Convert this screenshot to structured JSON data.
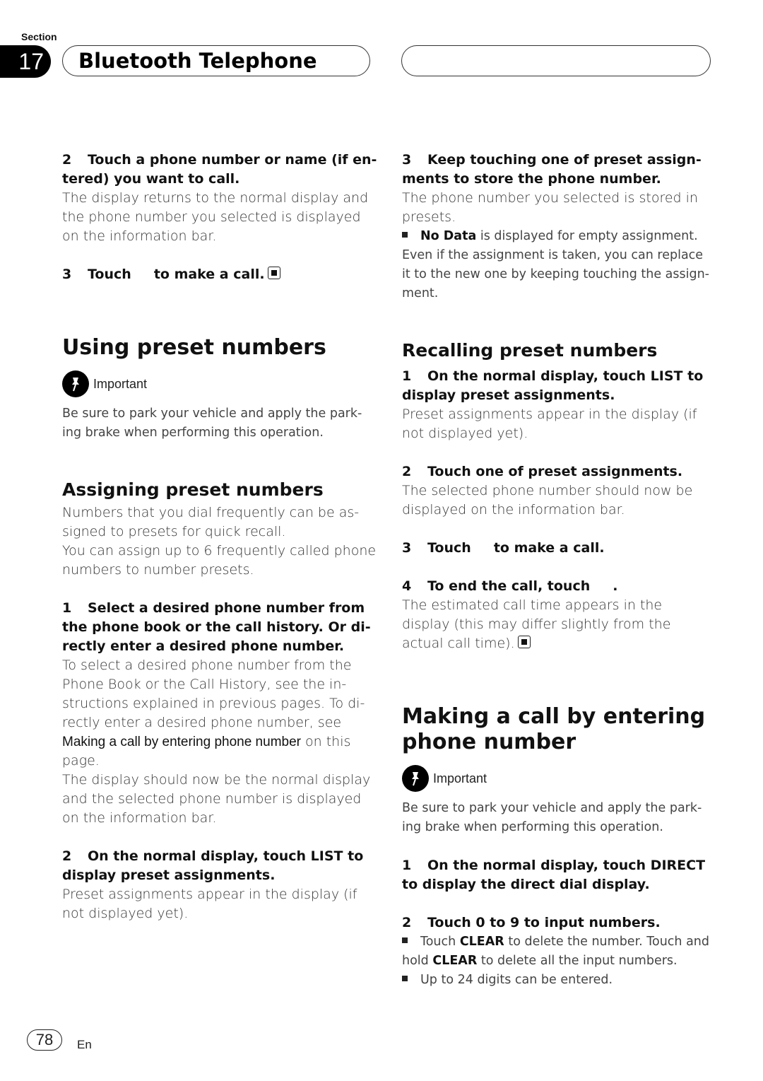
{
  "header": {
    "section_label": "Section",
    "section_number": "17",
    "title": "Bluetooth Telephone"
  },
  "left": {
    "step2": {
      "num": "2",
      "text": "Touch a phone number or name (if en-tered) you want to call."
    },
    "step2_body": "The display returns to the normal display and the phone number you selected is displayed on the information bar.",
    "step3": {
      "num": "3",
      "pre": "Touch",
      "post": "to make a call."
    },
    "using": {
      "title": "Using preset numbers",
      "important_label": "Important",
      "important_text": "Be sure to park your vehicle and apply the park-ing brake when performing this operation."
    },
    "assigning": {
      "title": "Assigning preset numbers",
      "p1": "Numbers that you dial frequently can be as-signed to presets for quick recall.",
      "p2": "You can assign up to 6 frequently called phone numbers to number presets.",
      "step1": {
        "num": "1",
        "text": "Select a desired phone number from the phone book or the call history. Or di-rectly enter a desired phone number."
      },
      "step1_body_pre": "To select a desired phone number from the Phone Book or the Call History, see the in-structions explained in previous pages. To di-rectly enter a desired phone number, see",
      "step1_ref": "Making a call by entering phone number",
      "step1_body_post": "on this page.",
      "step1_body2": "The display should now be the normal display and the selected phone number is displayed on the information bar.",
      "step2": {
        "num": "2",
        "text": "On the normal display, touch LIST to display preset assignments."
      },
      "step2_body": "Preset assignments appear in the display (if not displayed yet)."
    }
  },
  "right": {
    "step3": {
      "num": "3",
      "text": "Keep touching one of preset assign-ments to store the phone number."
    },
    "step3_body": "The phone number you selected is stored in presets.",
    "note_bold": "No Data",
    "note_text": "is displayed for empty assignment. Even if the assignment is taken, you can replace it to the new one by keeping touching the assign-ment.",
    "recalling": {
      "title": "Recalling preset numbers",
      "step1": {
        "num": "1",
        "text": "On the normal display, touch LIST to display preset assignments."
      },
      "step1_body": "Preset assignments appear in the display (if not displayed yet).",
      "step2": {
        "num": "2",
        "text": "Touch one of preset assignments."
      },
      "step2_body": "The selected phone number should now be displayed on the information bar.",
      "step3": {
        "num": "3",
        "pre": "Touch",
        "post": "to make a call."
      },
      "step4": {
        "num": "4",
        "pre": "To end the call, touch",
        "post": "."
      },
      "step4_body": "The estimated call time appears in the display (this may differ slightly from the actual call time)."
    },
    "making": {
      "title": "Making a call by entering phone number",
      "important_label": "Important",
      "important_text": "Be sure to park your vehicle and apply the park-ing brake when performing this operation.",
      "step1": {
        "num": "1",
        "text": "On the normal display, touch DIRECT to display the direct dial display."
      },
      "step2": {
        "num": "2",
        "text": "Touch 0 to 9 to input numbers."
      },
      "b1_pre": "Touch",
      "b1_bold1": "CLEAR",
      "b1_mid": "to delete the number. Touch and hold",
      "b1_bold2": "CLEAR",
      "b1_post": "to delete all the input numbers.",
      "b2": "Up to 24 digits can be entered."
    }
  },
  "footer": {
    "page": "78",
    "lang": "En"
  }
}
